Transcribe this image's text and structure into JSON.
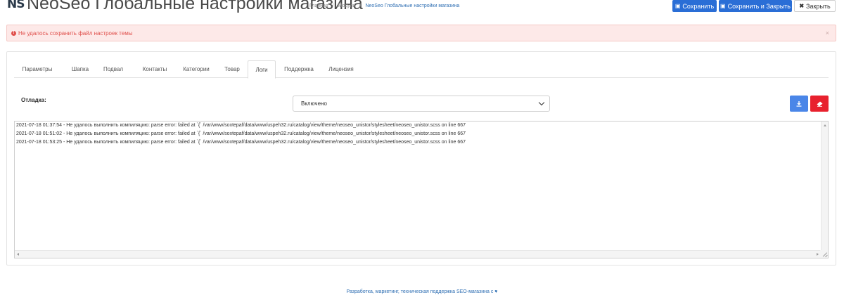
{
  "header": {
    "logo": "NS",
    "title": "NeoSeo Глобальные настройки магазина",
    "breadcrumb": [
      "Главная",
      "Модули",
      "NeoSeo Глобальные настройки магазина"
    ],
    "breadcrumb_sep": "/",
    "buttons": {
      "save": "Сохранить",
      "save_close": "Сохранить и Закрыть",
      "close": "Закрыть"
    }
  },
  "alert": {
    "text": "Не удалось сохранить файл настроек темы",
    "close": "×",
    "color": "#e0504c"
  },
  "tabs": [
    {
      "label": "Параметры",
      "active": false
    },
    {
      "label": "Шапка",
      "active": false
    },
    {
      "label": "Подвал",
      "active": false
    },
    {
      "label": "Контакты",
      "active": false
    },
    {
      "label": "Категории",
      "active": false
    },
    {
      "label": "Товар",
      "active": false
    },
    {
      "label": "Логи",
      "active": true
    },
    {
      "label": "Поддержка",
      "active": false
    },
    {
      "label": "Лицензия",
      "active": false
    }
  ],
  "debug": {
    "label": "Отладка:",
    "selected": "Включено"
  },
  "logs": [
    "2021-07-18 01:37:54 - Не удалось выполнить компиляцию: parse error: failed at `{` /var/www/soxtepaf/data/www/uspeh32.ru/catalog/view/theme/neoseo_unistor/stylesheet/neoseo_unistor.scss on line 667",
    "2021-07-18 01:51:02 - Не удалось выполнить компиляцию: parse error: failed at `{` /var/www/soxtepaf/data/www/uspeh32.ru/catalog/view/theme/neoseo_unistor/stylesheet/neoseo_unistor.scss on line 667",
    "2021-07-18 01:53:25 - Не удалось выполнить компиляцию: parse error: failed at `{` /var/www/soxtepaf/data/www/uspeh32.ru/catalog/view/theme/neoseo_unistor/stylesheet/neoseo_unistor.scss on line 667"
  ],
  "footer": {
    "text": "Разработка, маркетинг, техническая поддержка SEO-магазина с ♥"
  },
  "colors": {
    "primary": "#2a6ed6",
    "danger": "#e8212e",
    "download": "#4a86e8"
  }
}
